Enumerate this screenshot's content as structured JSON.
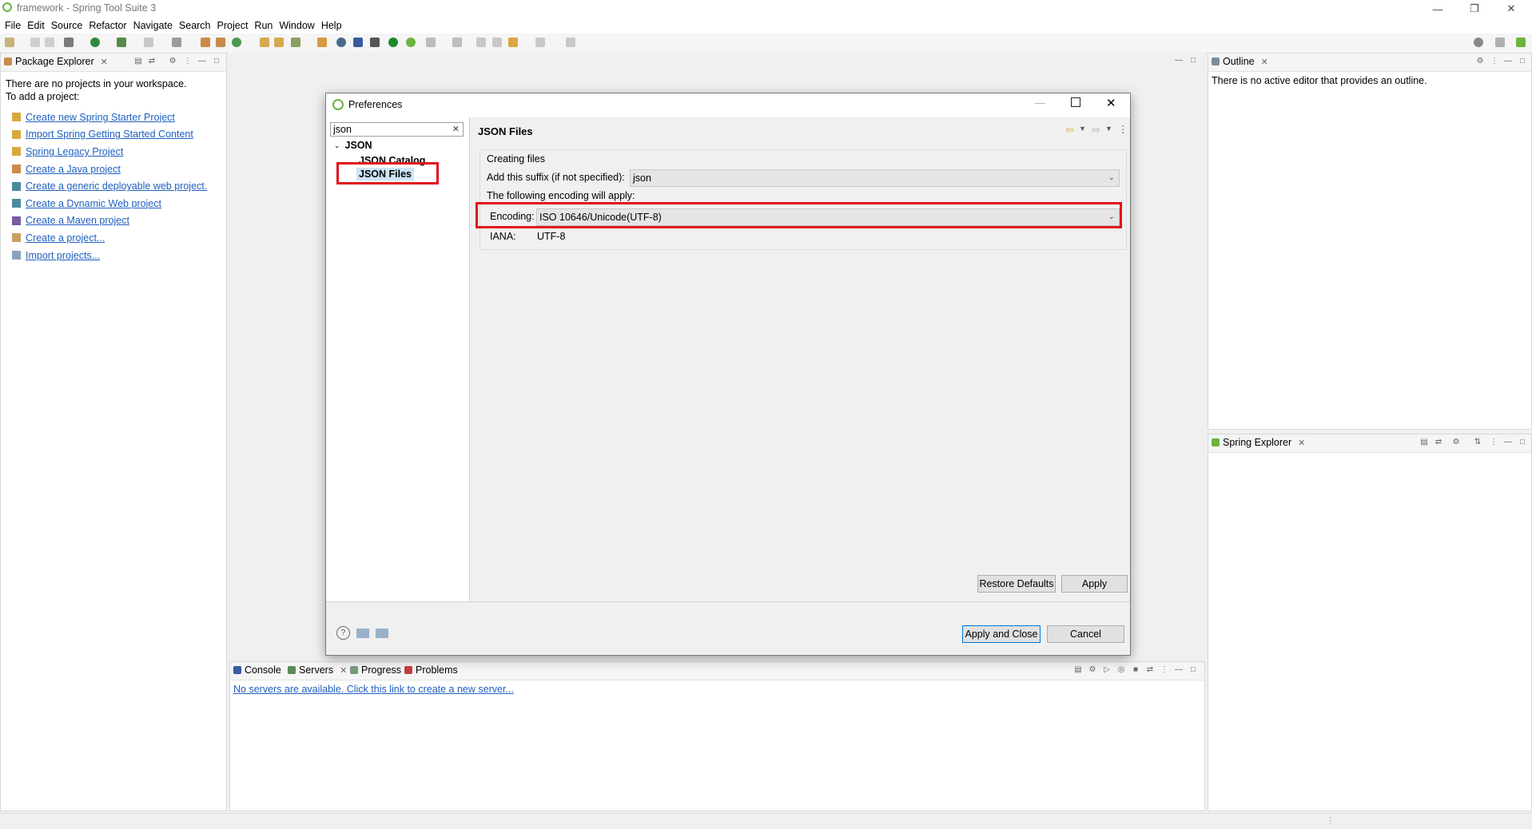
{
  "window": {
    "title": "framework - Spring Tool Suite 3"
  },
  "menu": [
    "File",
    "Edit",
    "Source",
    "Refactor",
    "Navigate",
    "Search",
    "Project",
    "Run",
    "Window",
    "Help"
  ],
  "package_explorer": {
    "tab": "Package Explorer",
    "message_line1": "There are no projects in your workspace.",
    "message_line2": "To add a project:",
    "links": [
      "Create new Spring Starter Project",
      "Import Spring Getting Started Content",
      "Spring Legacy Project",
      "Create a Java project",
      "Create a generic deployable web project.",
      "Create a Dynamic Web project",
      "Create a Maven project",
      "Create a project...",
      "Import projects..."
    ]
  },
  "outline": {
    "tab": "Outline",
    "message": "There is no active editor that provides an outline."
  },
  "spring_explorer": {
    "tab": "Spring Explorer"
  },
  "bottom_panel": {
    "tabs": [
      "Console",
      "Servers",
      "Progress",
      "Problems"
    ],
    "servers_link": "No servers are available. Click this link to create a new server..."
  },
  "preferences": {
    "title": "Preferences",
    "filter_value": "json",
    "tree": {
      "root": "JSON",
      "children": [
        "JSON Catalog",
        "JSON Files"
      ]
    },
    "page_title": "JSON Files",
    "group_label": "Creating files",
    "suffix_label": "Add this suffix (if not specified):",
    "suffix_value": "json",
    "encoding_intro": "The following encoding will apply:",
    "encoding_label": "Encoding:",
    "encoding_value": "ISO 10646/Unicode(UTF-8)",
    "iana_label": "IANA:",
    "iana_value": "UTF-8",
    "restore_defaults": "Restore Defaults",
    "apply": "Apply",
    "apply_and_close": "Apply and Close",
    "cancel": "Cancel"
  }
}
